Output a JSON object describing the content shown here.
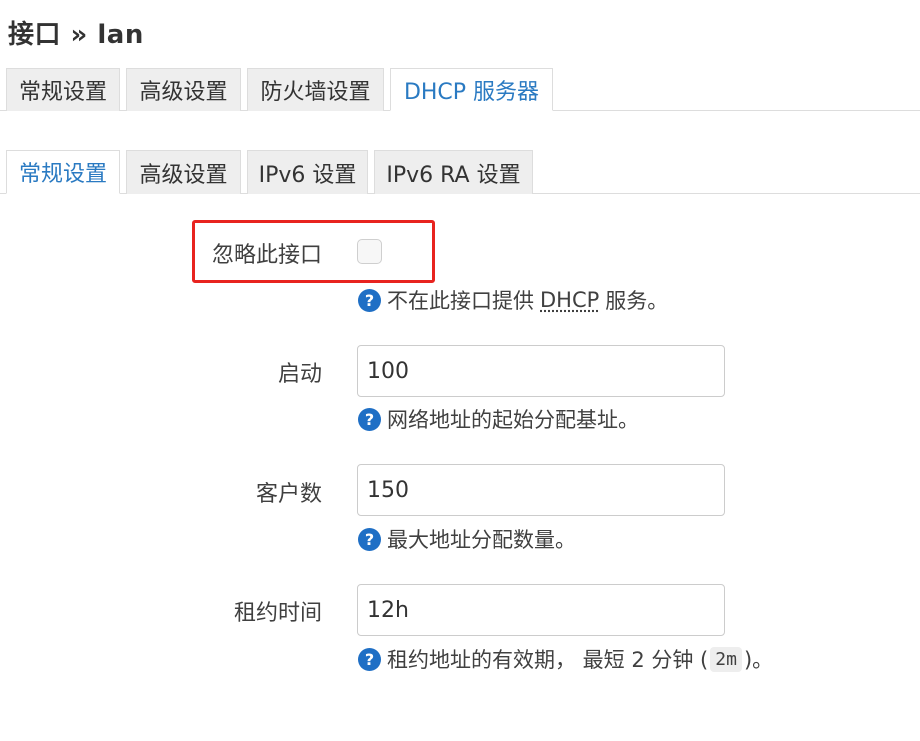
{
  "page": {
    "title": "接口 » lan"
  },
  "top_tabs": [
    {
      "label": "常规设置",
      "active": false
    },
    {
      "label": "高级设置",
      "active": false
    },
    {
      "label": "防火墙设置",
      "active": false
    },
    {
      "label": "DHCP 服务器",
      "active": true
    }
  ],
  "sub_tabs": [
    {
      "label": "常规设置",
      "active": true
    },
    {
      "label": "高级设置",
      "active": false
    },
    {
      "label": "IPv6 设置",
      "active": false
    },
    {
      "label": "IPv6 RA 设置",
      "active": false
    }
  ],
  "fields": {
    "ignore": {
      "label": "忽略此接口",
      "checked": false,
      "help_prefix": "不在此接口提供",
      "help_abbr": "DHCP",
      "help_suffix": "服务。"
    },
    "start": {
      "label": "启动",
      "value": "100",
      "help": "网络地址的起始分配基址。"
    },
    "limit": {
      "label": "客户数",
      "value": "150",
      "help": "最大地址分配数量。"
    },
    "leasetime": {
      "label": "租约时间",
      "value": "12h",
      "help_prefix": "租约地址的有效期， 最短 2 分钟 (",
      "help_code": "2m",
      "help_suffix": ")。"
    }
  },
  "icons": {
    "help": "question-circle-icon"
  },
  "colors": {
    "accent": "#2a7ac2",
    "highlight": "#e8231f",
    "help_icon": "#1f6fc5"
  }
}
